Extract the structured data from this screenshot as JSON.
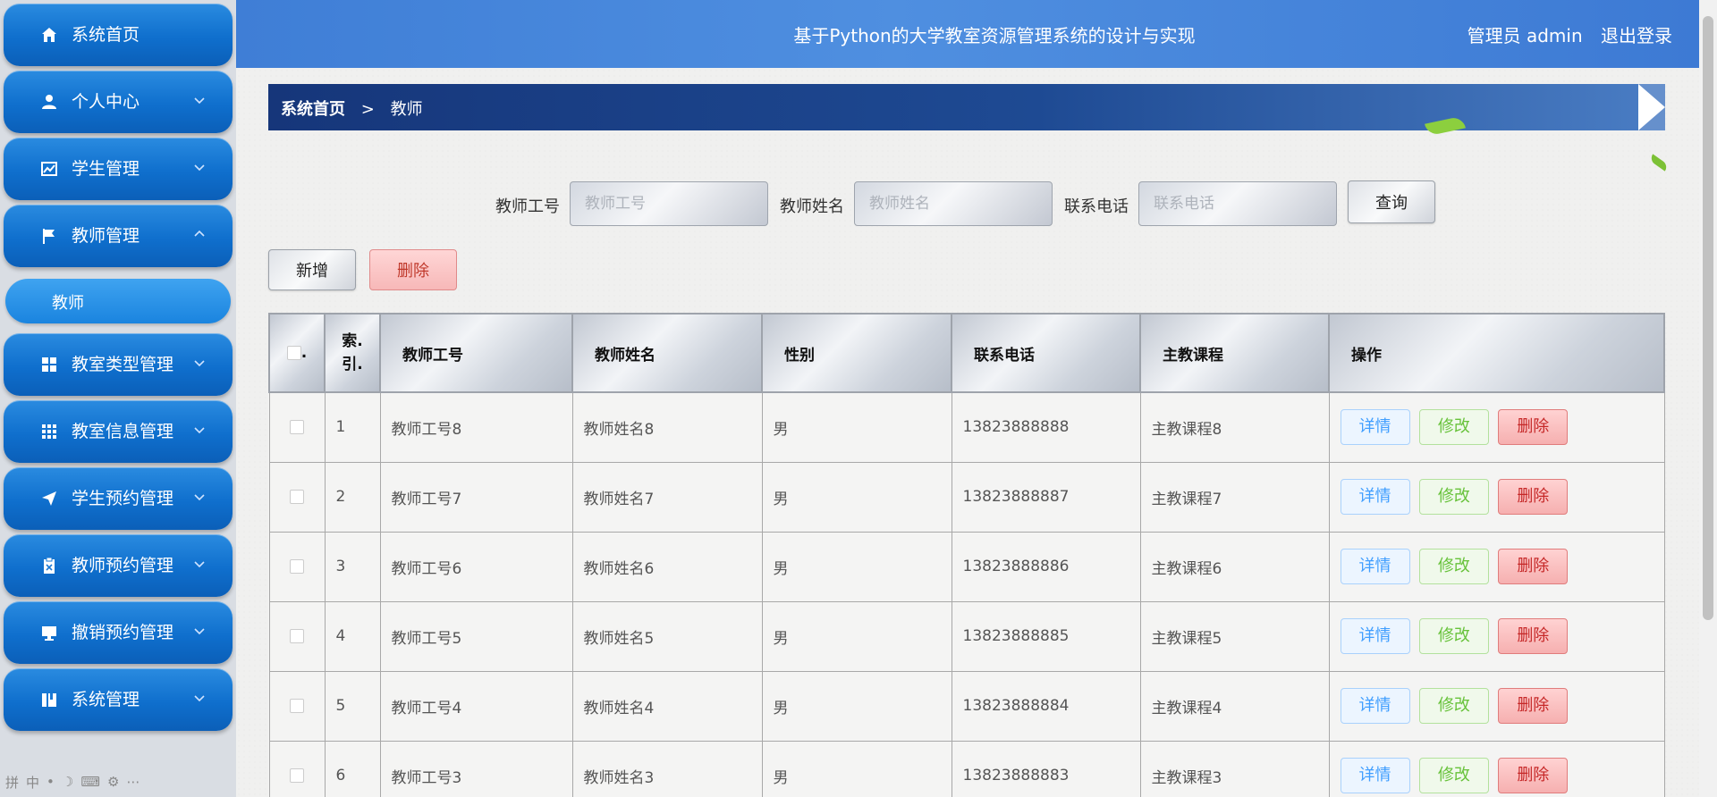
{
  "sidebar": {
    "items": [
      {
        "label": "系统首页",
        "icon": "home-icon"
      },
      {
        "label": "个人中心",
        "icon": "user-icon"
      },
      {
        "label": "学生管理",
        "icon": "chart-icon"
      },
      {
        "label": "教师管理",
        "icon": "flag-icon"
      },
      {
        "label": "教室类型管理",
        "icon": "grid-icon"
      },
      {
        "label": "教室信息管理",
        "icon": "apps-icon"
      },
      {
        "label": "学生预约管理",
        "icon": "send-icon"
      },
      {
        "label": "教师预约管理",
        "icon": "clipboard-icon"
      },
      {
        "label": "撤销预约管理",
        "icon": "monitor-icon"
      },
      {
        "label": "系统管理",
        "icon": "book-icon"
      }
    ],
    "submenu": {
      "label": "教师"
    }
  },
  "header": {
    "title": "基于Python的大学教室资源管理系统的设计与实现",
    "user": "管理员 admin",
    "logout": "退出登录"
  },
  "breadcrumb": {
    "home": "系统首页",
    "separator": ">",
    "current": "教师"
  },
  "search": {
    "fields": [
      {
        "label": "教师工号",
        "placeholder": "教师工号"
      },
      {
        "label": "教师姓名",
        "placeholder": "教师姓名"
      },
      {
        "label": "联系电话",
        "placeholder": "联系电话"
      }
    ],
    "query_label": "查询"
  },
  "actions": {
    "add_label": "新增",
    "delete_label": "删除"
  },
  "table": {
    "headers": {
      "check": ".",
      "index": "索.\n引.",
      "teacher_id": "教师工号",
      "teacher_name": "教师姓名",
      "gender": "性别",
      "phone": "联系电话",
      "course": "主教课程",
      "ops": "操作"
    },
    "op_labels": {
      "detail": "详情",
      "edit": "修改",
      "delete": "删除"
    },
    "rows": [
      {
        "index": "1",
        "teacher_id": "教师工号8",
        "teacher_name": "教师姓名8",
        "gender": "男",
        "phone": "13823888888",
        "course": "主教课程8"
      },
      {
        "index": "2",
        "teacher_id": "教师工号7",
        "teacher_name": "教师姓名7",
        "gender": "男",
        "phone": "13823888887",
        "course": "主教课程7"
      },
      {
        "index": "3",
        "teacher_id": "教师工号6",
        "teacher_name": "教师姓名6",
        "gender": "男",
        "phone": "13823888886",
        "course": "主教课程6"
      },
      {
        "index": "4",
        "teacher_id": "教师工号5",
        "teacher_name": "教师姓名5",
        "gender": "男",
        "phone": "13823888885",
        "course": "主教课程5"
      },
      {
        "index": "5",
        "teacher_id": "教师工号4",
        "teacher_name": "教师姓名4",
        "gender": "男",
        "phone": "13823888884",
        "course": "主教课程4"
      },
      {
        "index": "6",
        "teacher_id": "教师工号3",
        "teacher_name": "教师姓名3",
        "gender": "男",
        "phone": "13823888883",
        "course": "主教课程3"
      }
    ]
  },
  "ime_bar": {
    "glyphs": [
      "拼",
      "中",
      "•",
      "☽",
      "⌨",
      "⚙",
      "⋯"
    ]
  }
}
